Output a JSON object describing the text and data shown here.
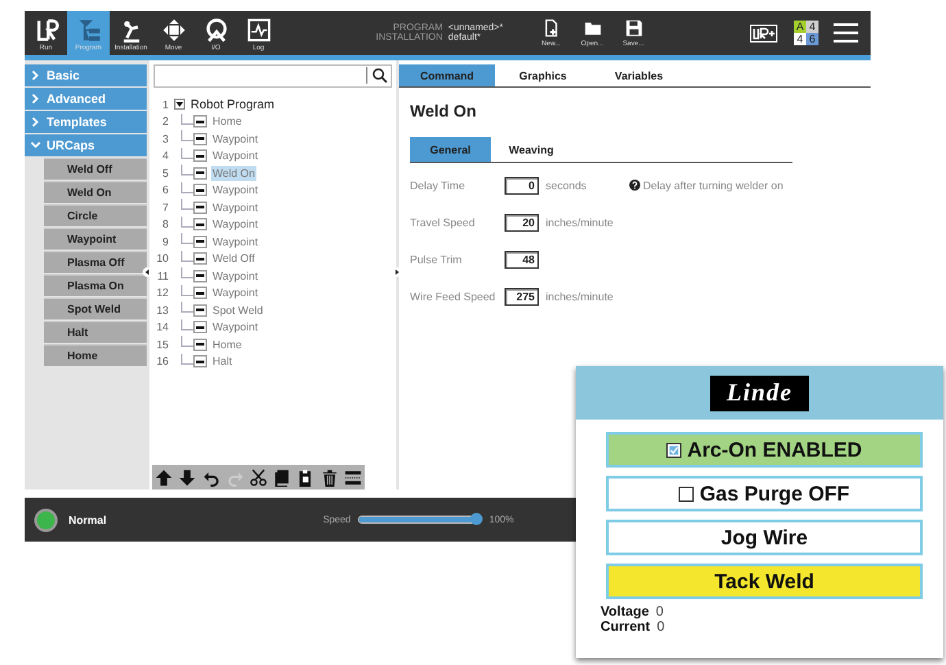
{
  "header": {
    "nav": [
      {
        "label": "Run",
        "selected": false
      },
      {
        "label": "Program",
        "selected": true
      },
      {
        "label": "Installation",
        "selected": false
      },
      {
        "label": "Move",
        "selected": false
      },
      {
        "label": "I/O",
        "selected": false
      },
      {
        "label": "Log",
        "selected": false
      }
    ],
    "program_label": "PROGRAM",
    "program_value": "<unnamed>*",
    "installation_label": "INSTALLATION",
    "installation_value": "default*",
    "file_buttons": [
      "New...",
      "Open...",
      "Save..."
    ],
    "status_grid": [
      "A",
      "4",
      "4",
      "6"
    ]
  },
  "sidebar": {
    "categories": [
      {
        "label": "Basic",
        "expanded": false
      },
      {
        "label": "Advanced",
        "expanded": false
      },
      {
        "label": "Templates",
        "expanded": false
      },
      {
        "label": "URCaps",
        "expanded": true
      }
    ],
    "items": [
      "Weld Off",
      "Weld On",
      "Circle",
      "Waypoint",
      "Plasma Off",
      "Plasma On",
      "Spot Weld",
      "Halt",
      "Home"
    ]
  },
  "tree": {
    "root": {
      "number": "1",
      "label": "Robot Program",
      "expanded": true,
      "children": [
        {
          "number": "2",
          "label": "Home",
          "selected": false
        },
        {
          "number": "3",
          "label": "Waypoint",
          "selected": false
        },
        {
          "number": "4",
          "label": "Waypoint",
          "selected": false
        },
        {
          "number": "5",
          "label": "Weld On",
          "selected": true
        },
        {
          "number": "6",
          "label": "Waypoint",
          "selected": false
        },
        {
          "number": "7",
          "label": "Waypoint",
          "selected": false
        },
        {
          "number": "8",
          "label": "Waypoint",
          "selected": false
        },
        {
          "number": "9",
          "label": "Waypoint",
          "selected": false
        },
        {
          "number": "10",
          "label": "Weld Off",
          "selected": false
        },
        {
          "number": "11",
          "label": "Waypoint",
          "selected": false
        },
        {
          "number": "12",
          "label": "Waypoint",
          "selected": false
        },
        {
          "number": "13",
          "label": "Spot Weld",
          "selected": false
        },
        {
          "number": "14",
          "label": "Waypoint",
          "selected": false
        },
        {
          "number": "15",
          "label": "Home",
          "selected": false
        },
        {
          "number": "16",
          "label": "Halt",
          "selected": false
        }
      ]
    },
    "toolbar": [
      {
        "kind": "up",
        "disabled": false
      },
      {
        "kind": "down",
        "disabled": false
      },
      {
        "kind": "undo",
        "disabled": false
      },
      {
        "kind": "redo",
        "disabled": true
      },
      {
        "kind": "cut",
        "disabled": false
      },
      {
        "kind": "copy",
        "disabled": false
      },
      {
        "kind": "paste",
        "disabled": false
      },
      {
        "kind": "delete",
        "disabled": false
      },
      {
        "kind": "suppress",
        "disabled": false
      }
    ]
  },
  "command_panel": {
    "tabs": [
      {
        "label": "Command",
        "selected": true
      },
      {
        "label": "Graphics",
        "selected": false
      },
      {
        "label": "Variables",
        "selected": false
      }
    ],
    "title": "Weld On",
    "subtabs": [
      {
        "label": "General",
        "selected": true
      },
      {
        "label": "Weaving",
        "selected": false
      }
    ],
    "fields": [
      {
        "label": "Delay Time",
        "value": "0",
        "unit": "seconds",
        "hint": "Delay after turning welder on"
      },
      {
        "label": "Travel Speed",
        "value": "20",
        "unit": "inches/minute"
      },
      {
        "label": "Pulse Trim",
        "value": "48"
      },
      {
        "label": "Wire Feed Speed",
        "value": "275",
        "unit": "inches/minute"
      }
    ]
  },
  "status_bar": {
    "state": "Normal",
    "speed_label": "Speed",
    "speed": {
      "level": 1.0
    },
    "speed_reading": "100%"
  },
  "welder_panel": {
    "logo": "Linde",
    "buttons": [
      {
        "kind": "checkbox",
        "label": "Arc-On ENABLED",
        "checked": true,
        "color": "#a3d483"
      },
      {
        "kind": "checkbox",
        "label": "Gas Purge OFF",
        "checked": false,
        "color": "#ffffff"
      },
      {
        "kind": "button",
        "label": "Jog Wire",
        "color": "#ffffff"
      },
      {
        "kind": "button",
        "label": "Tack Weld",
        "color": "#f3e62c"
      }
    ],
    "readings": [
      {
        "label": "Voltage",
        "value": "0"
      },
      {
        "label": "Current",
        "value": "0"
      }
    ]
  }
}
